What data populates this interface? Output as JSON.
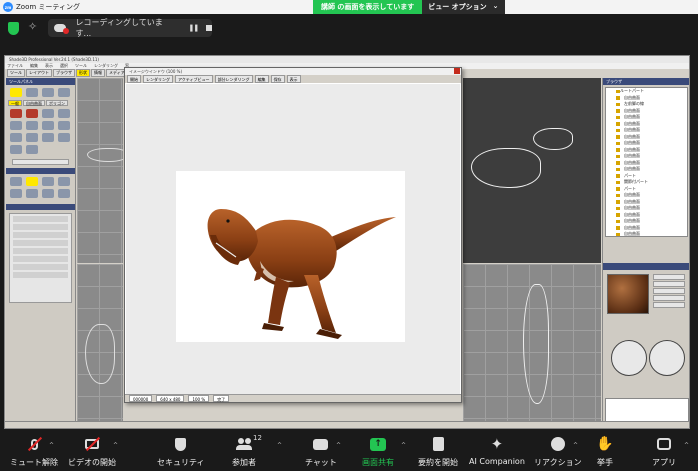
{
  "zoom": {
    "window_title": "Zoom ミーティング",
    "share_banner_text": "講師 の画面を表示しています",
    "view_options_label": "ビュー オプション",
    "view_options_caret": "⌄",
    "recording_text": "レコーディングしています...",
    "toolbar": {
      "mute_label": "ミュート解除",
      "video_label": "ビデオの開始",
      "security_label": "セキュリティ",
      "participants_label": "参加者",
      "participants_count": "12",
      "chat_label": "チャット",
      "share_label": "画面共有",
      "summary_label": "要約を開始",
      "ai_label": "AI Companion",
      "reaction_label": "リアクション",
      "raise_hand_label": "挙手",
      "apps_label": "アプリ"
    }
  },
  "shade": {
    "title": "Shade3D Professional Ver.24.1 (Shade3D.11)",
    "menu": [
      "ファイル",
      "編集",
      "表示",
      "選択",
      "ツール",
      "レンダリング",
      "窓"
    ],
    "toolbar": [
      "ツール",
      "レイアウト",
      "ブラウザ",
      "形状",
      "情報",
      "メディア"
    ],
    "active_toolbar_index": 3,
    "left_panel_title": "ツールパネル",
    "left_tabs": [
      "一般",
      "自由曲面",
      "ポリゴン"
    ],
    "right_panel_title": "ブラウザ",
    "tree_root": "ルートパート",
    "tree_items": [
      "自由曲面",
      "左前脚の線",
      "自由曲面",
      "自由曲面",
      "自由曲面",
      "自由曲面",
      "自由曲面",
      "自由曲面",
      "自由曲面",
      "自由曲面",
      "自由曲面",
      "自由曲面",
      "パート",
      "関節付パート",
      "パート",
      "自由曲面",
      "自由曲面",
      "自由曲面",
      "自由曲面",
      "自由曲面",
      "自由曲面",
      "自由曲面"
    ]
  },
  "image_window": {
    "title": "イメージウインドウ (100 %)",
    "toolbar": [
      "開始",
      "レンダリング",
      "アクティブビュー",
      "部分レンダリング",
      "編集",
      "保存",
      "表示"
    ],
    "status": [
      "000000",
      "640 x 480",
      "100 %",
      "完了"
    ]
  },
  "colors": {
    "zoom_green": "#23c552",
    "zoom_bg": "#1a1a1a",
    "record_red": "#e02828",
    "dino_body": "#a0521e"
  }
}
